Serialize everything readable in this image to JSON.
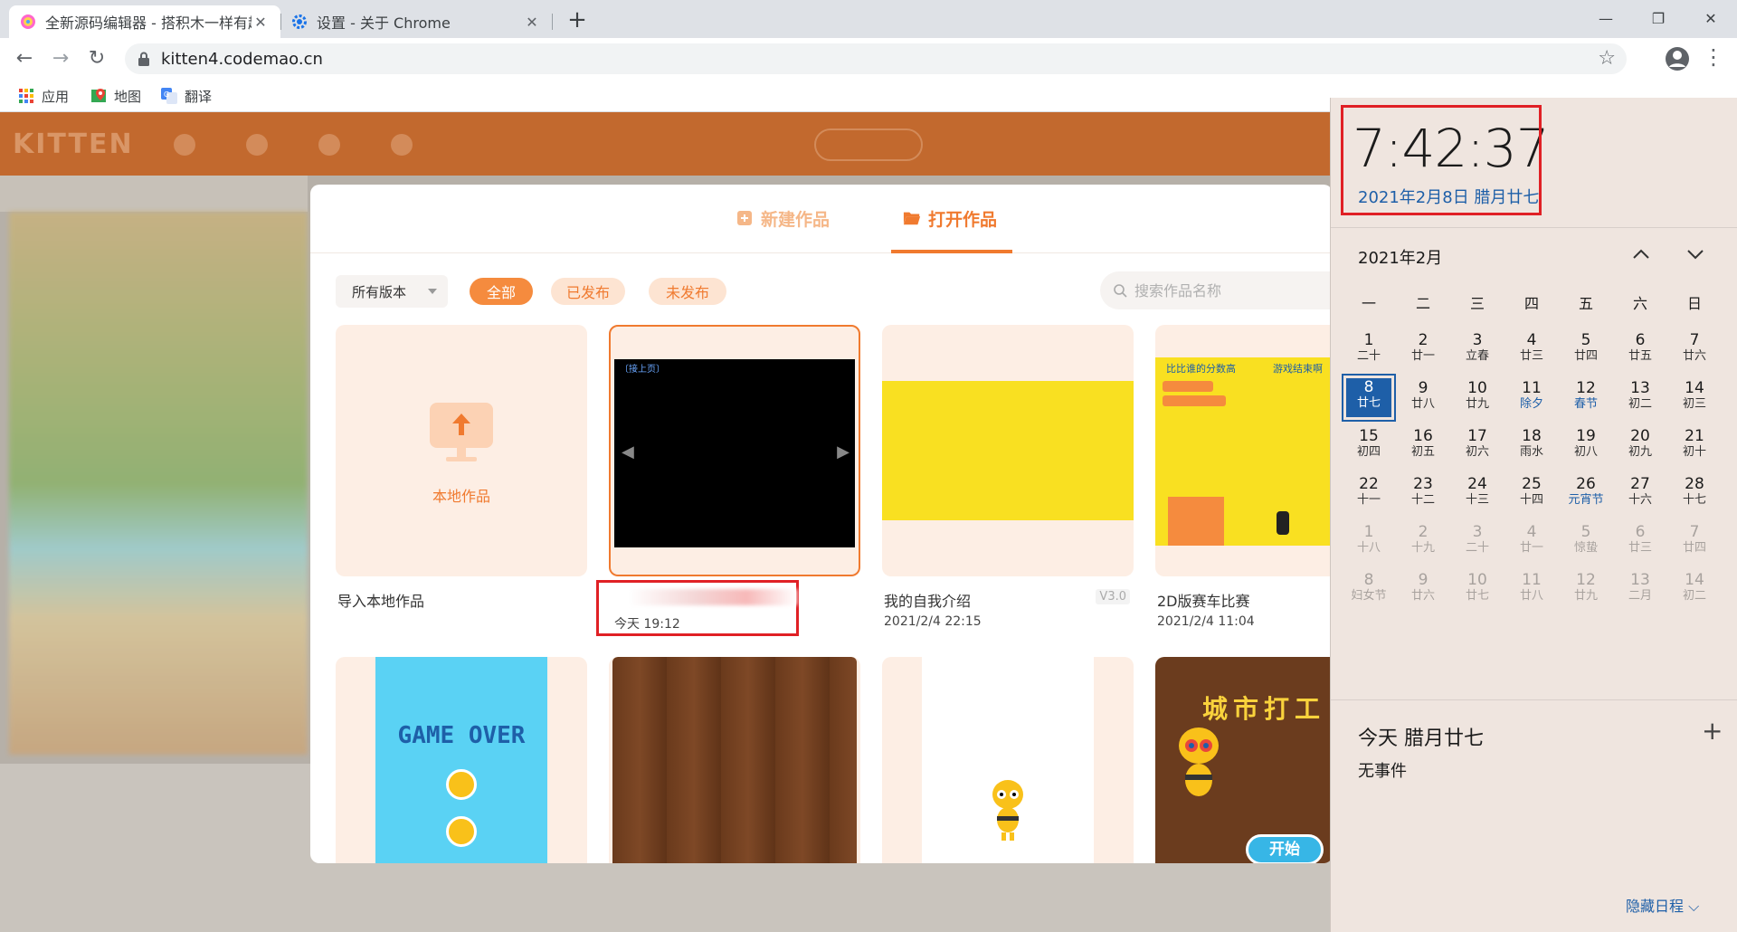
{
  "browser": {
    "tabs": [
      {
        "title": "全新源码编辑器 - 搭积木一样有趣",
        "close": "✕"
      },
      {
        "title": "设置 - 关于 Chrome",
        "close": "✕"
      }
    ],
    "new_tab": "+",
    "window_controls": {
      "minimize": "—",
      "restore": "❐",
      "close": "✕"
    },
    "url": "kitten4.codemao.cn",
    "bookmarks": [
      "应用",
      "地图",
      "翻译"
    ]
  },
  "app": {
    "logo": "KITTEN"
  },
  "modal": {
    "tab_new": "新建作品",
    "tab_open": "打开作品",
    "version_select": "所有版本",
    "filters": {
      "all": "全部",
      "published": "已发布",
      "unpublished": "未发布"
    },
    "search_placeholder": "搜索作品名称",
    "cards": [
      {
        "thumb_label": "本地作品",
        "name": "导入本地作品",
        "date": ""
      },
      {
        "thumb_label": "〔接上页〕",
        "name": "",
        "date": "今天 19:12"
      },
      {
        "name": "我的自我介绍",
        "date": "2021/2/4 22:15",
        "badge": "V3.0"
      },
      {
        "thumb_label_left": "比比谁的分数高",
        "thumb_label_right": "游戏结束啊",
        "name": "2D版赛车比赛",
        "date": "2021/2/4 11:04"
      },
      {
        "thumb_label": "GAME OVER"
      },
      {},
      {},
      {
        "thumb_label": "城市打工",
        "button_label": "开始"
      }
    ]
  },
  "calendar": {
    "time": "7:42:37",
    "full_date": "2021年2月8日 腊月廿七",
    "month": "2021年2月",
    "weekdays": [
      "一",
      "二",
      "三",
      "四",
      "五",
      "六",
      "日"
    ],
    "days": [
      {
        "n": "1",
        "l": "二十"
      },
      {
        "n": "2",
        "l": "廿一"
      },
      {
        "n": "3",
        "l": "立春"
      },
      {
        "n": "4",
        "l": "廿三"
      },
      {
        "n": "5",
        "l": "廿四"
      },
      {
        "n": "6",
        "l": "廿五"
      },
      {
        "n": "7",
        "l": "廿六"
      },
      {
        "n": "8",
        "l": "廿七"
      },
      {
        "n": "9",
        "l": "廿八"
      },
      {
        "n": "10",
        "l": "廿九"
      },
      {
        "n": "11",
        "l": "除夕"
      },
      {
        "n": "12",
        "l": "春节"
      },
      {
        "n": "13",
        "l": "初二"
      },
      {
        "n": "14",
        "l": "初三"
      },
      {
        "n": "15",
        "l": "初四"
      },
      {
        "n": "16",
        "l": "初五"
      },
      {
        "n": "17",
        "l": "初六"
      },
      {
        "n": "18",
        "l": "雨水"
      },
      {
        "n": "19",
        "l": "初八"
      },
      {
        "n": "20",
        "l": "初九"
      },
      {
        "n": "21",
        "l": "初十"
      },
      {
        "n": "22",
        "l": "十一"
      },
      {
        "n": "23",
        "l": "十二"
      },
      {
        "n": "24",
        "l": "十三"
      },
      {
        "n": "25",
        "l": "十四"
      },
      {
        "n": "26",
        "l": "元宵节"
      },
      {
        "n": "27",
        "l": "十六"
      },
      {
        "n": "28",
        "l": "十七"
      },
      {
        "n": "1",
        "l": "十八"
      },
      {
        "n": "2",
        "l": "十九"
      },
      {
        "n": "3",
        "l": "二十"
      },
      {
        "n": "4",
        "l": "廿一"
      },
      {
        "n": "5",
        "l": "惊蛰"
      },
      {
        "n": "6",
        "l": "廿三"
      },
      {
        "n": "7",
        "l": "廿四"
      },
      {
        "n": "8",
        "l": "妇女节"
      },
      {
        "n": "9",
        "l": "廿六"
      },
      {
        "n": "10",
        "l": "廿七"
      },
      {
        "n": "11",
        "l": "廿八"
      },
      {
        "n": "12",
        "l": "廿九"
      },
      {
        "n": "13",
        "l": "二月"
      },
      {
        "n": "14",
        "l": "初二"
      }
    ],
    "agenda_title": "今天 腊月廿七",
    "agenda_add": "+",
    "agenda_empty": "无事件",
    "hide_agenda": "隐藏日程 ⌵"
  },
  "colors": {
    "accent": "#f07a2f",
    "calendar_accent": "#1e5fa8",
    "highlight_red": "#e02025"
  }
}
